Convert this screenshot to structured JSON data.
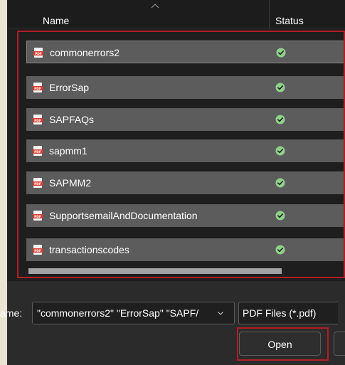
{
  "header": {
    "name_label": "Name",
    "status_label": "Status"
  },
  "files": [
    {
      "name": "commonerrors2",
      "status": "available-offline"
    },
    {
      "name": "ErrorSap",
      "status": "available-offline"
    },
    {
      "name": "SAPFAQs",
      "status": "available-offline"
    },
    {
      "name": "sapmm1",
      "status": "available-offline"
    },
    {
      "name": "SAPMM2",
      "status": "available-offline"
    },
    {
      "name": "SupportsemailAndDocumentation",
      "status": "available-offline"
    },
    {
      "name": "transactionscodes",
      "status": "available-offline"
    }
  ],
  "footer": {
    "file_name_label": "ame:",
    "file_name_value": "\"commonerrors2\" \"ErrorSap\" \"SAPF/",
    "file_type_value": "PDF Files (*.pdf)",
    "open_label": "Open"
  },
  "icons": {
    "file": "pdf-file-icon",
    "status": "checkmark-circle-icon",
    "dropdown": "chevron-down-icon",
    "sort": "sort-caret-icon"
  },
  "colors": {
    "highlight": "#b01e25",
    "status_check": "#8fd18b",
    "pdf_icon": "#e03b2f",
    "row_bg": "#5c5c5c"
  }
}
